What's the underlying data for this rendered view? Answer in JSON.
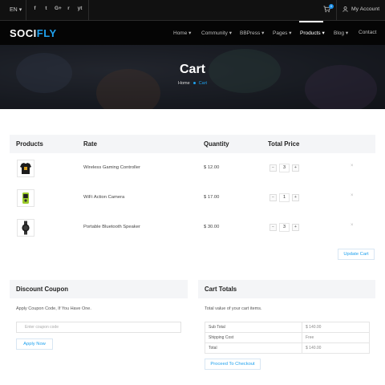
{
  "topbar": {
    "language": "EN",
    "social_icons": [
      "facebook-icon",
      "twitter-icon",
      "google-plus-icon",
      "rss-icon",
      "youtube-icon"
    ],
    "social_glyphs": [
      "f",
      "t",
      "G+",
      "r",
      "yt"
    ],
    "cart_count": "0",
    "account_label": "My Account"
  },
  "header": {
    "logo_main": "SOCI",
    "logo_accent": "FLY",
    "nav": [
      {
        "label": "Home",
        "dropdown": true
      },
      {
        "label": "Community",
        "dropdown": true
      },
      {
        "label": "BBPress",
        "dropdown": true
      },
      {
        "label": "Pages",
        "dropdown": true
      },
      {
        "label": "Products",
        "dropdown": true,
        "active": true
      },
      {
        "label": "Blog",
        "dropdown": true
      },
      {
        "label": "Contact",
        "dropdown": false
      }
    ]
  },
  "hero": {
    "title": "Cart",
    "breadcrumb_home": "Home",
    "breadcrumb_current": "Cart"
  },
  "cart": {
    "columns": [
      "Products",
      "Rate",
      "Quantity",
      "Total Price"
    ],
    "items": [
      {
        "thumb": "tshirt-image",
        "name": "Wireless Gaming Controller",
        "rate": "$ 12.00",
        "qty": "3"
      },
      {
        "thumb": "action-camera-image",
        "name": "WiFi Action Camera",
        "rate": "$ 17.00",
        "qty": "1"
      },
      {
        "thumb": "smartwatch-image",
        "name": "Portable Bluetooth Speaker",
        "rate": "$ 30.00",
        "qty": "3"
      }
    ],
    "update_button": "Update Cart"
  },
  "coupon": {
    "title": "Discount Coupon",
    "text": "Apply Coupon Code, If You Have One.",
    "placeholder": "Enter coupon code",
    "apply_button": "Apply Now"
  },
  "totals": {
    "title": "Cart Totals",
    "text": "Total value of your cart items.",
    "rows": [
      {
        "label": "Sub Total",
        "value": "$ 140.00"
      },
      {
        "label": "Shipping Cost",
        "value": "Free"
      },
      {
        "label": "Total",
        "value": "$ 140.00"
      }
    ],
    "checkout_button": "Proceed To Checkout"
  },
  "colors": {
    "accent": "#1fa1ee",
    "topbar_bg": "#111111",
    "header_bg": "#050505",
    "panel_bg": "#f4f5f7"
  }
}
